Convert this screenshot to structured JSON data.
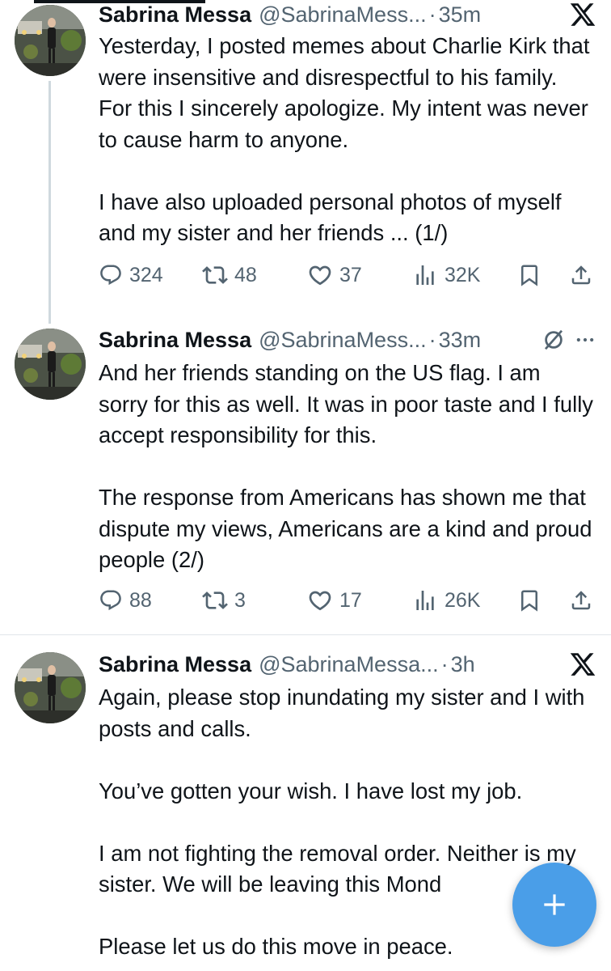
{
  "tweets": [
    {
      "author": "Sabrina Messa",
      "handle": "@SabrinaMess...",
      "separator": "·",
      "time": "35m",
      "header_icon": "x-logo-icon",
      "paragraphs": [
        "Yesterday, I posted memes about Charlie Kirk that were insensitive and disrespectful to his family.  For this I sincerely apologize.  My intent was never to cause harm to anyone.",
        "I have also uploaded personal photos of myself and my sister and her friends ... (1/)"
      ],
      "stats": {
        "replies": "324",
        "reposts": "48",
        "likes": "37",
        "views": "32K"
      }
    },
    {
      "author": "Sabrina Messa",
      "handle": "@SabrinaMess...",
      "separator": "·",
      "time": "33m",
      "header_icon": "grok-icon",
      "paragraphs": [
        "And her friends standing on the US flag.  I am sorry for this as well.  It was in poor taste and I fully accept responsibility for this.",
        "The response from Americans has shown me that dispute my views, Americans are a kind and proud people (2/)"
      ],
      "stats": {
        "replies": "88",
        "reposts": "3",
        "likes": "17",
        "views": "26K"
      }
    },
    {
      "author": "Sabrina Messa",
      "handle": "@SabrinaMessa...",
      "separator": "·",
      "time": "3h",
      "header_icon": "x-logo-icon",
      "paragraphs": [
        "Again, please stop inundating my sister and I with posts and calls.",
        "You’ve gotten your wish.  I have lost my job.",
        "I am not fighting the removal order. Neither is my sister.  We will be leaving this Mond",
        "Please let us do this move in peace."
      ]
    }
  ],
  "fab": {
    "icon": "plus-icon",
    "color": "#4a9ee8"
  },
  "colors": {
    "text": "#0f1419",
    "secondary": "#536471",
    "divider": "#e1e6ea",
    "thread_line": "#cfd9de"
  }
}
